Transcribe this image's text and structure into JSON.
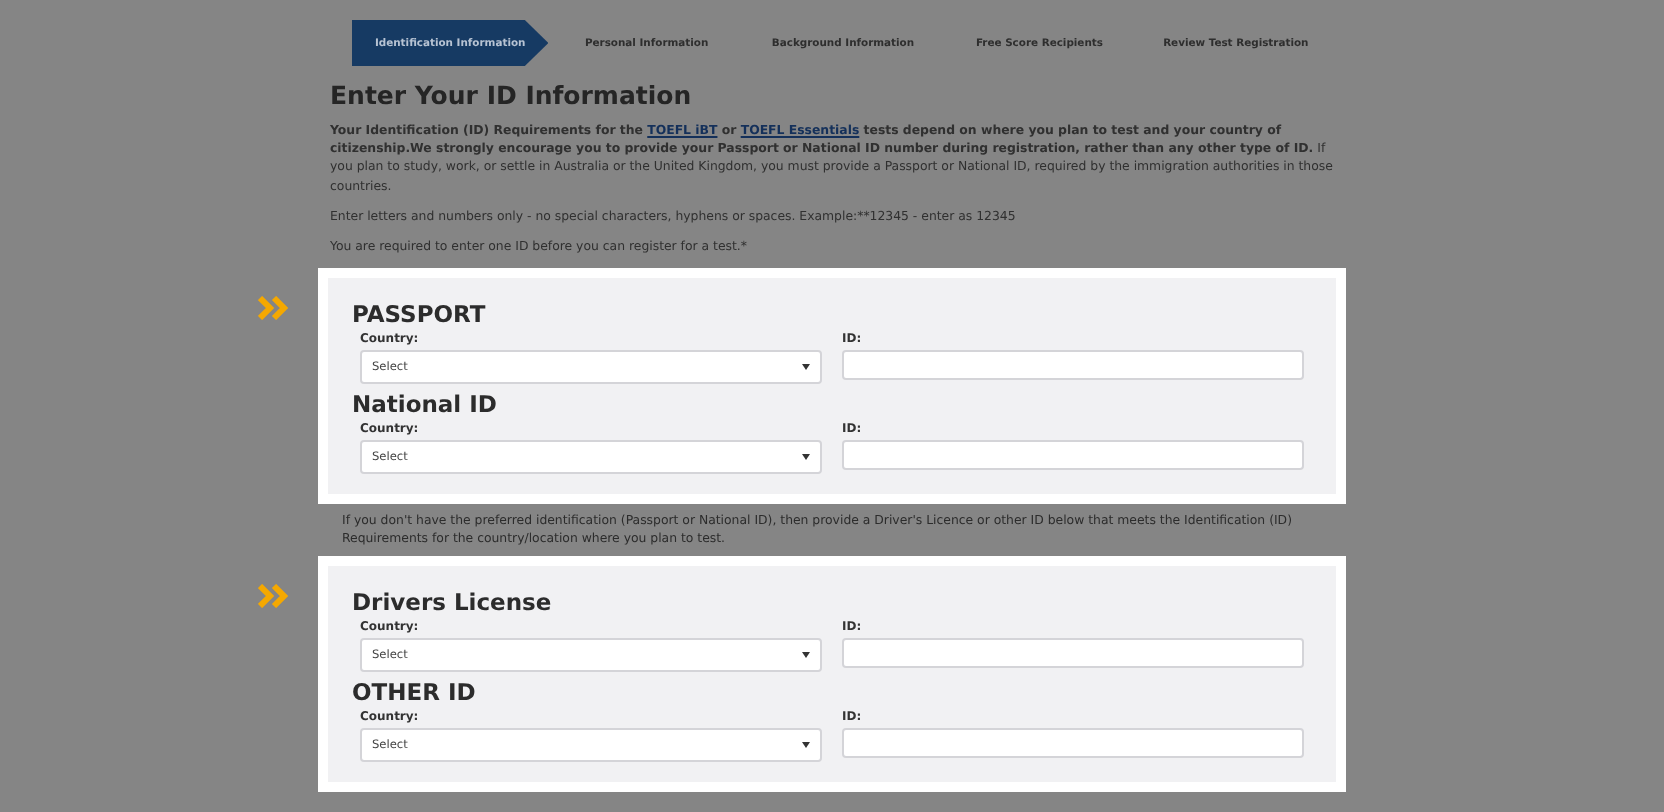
{
  "steps": [
    {
      "label": "Identification Information",
      "selected": true
    },
    {
      "label": "Personal Information",
      "selected": false
    },
    {
      "label": "Background Information",
      "selected": false
    },
    {
      "label": "Free Score Recipients",
      "selected": false
    },
    {
      "label": "Review Test Registration",
      "selected": false
    }
  ],
  "title": "Enter Your ID Information",
  "intro": [
    {
      "kind": "bold",
      "text": "Your Identification (ID) Requirements for the "
    },
    {
      "kind": "link",
      "text": "TOEFL iBT"
    },
    {
      "kind": "bold",
      "text": " or "
    },
    {
      "kind": "link",
      "text": "TOEFL Essentials"
    },
    {
      "kind": "bold",
      "text": " tests depend on where you plan to test and your country of citizenship.We strongly encourage you to provide your Passport or National ID number during registration, rather than any other type of ID."
    },
    {
      "kind": "plain",
      "text": " If you plan to study, work, or settle in Australia or the United Kingdom, you must provide a Passport or National ID, required by the immigration authorities in those countries."
    }
  ],
  "notes": [
    "Enter letters and numbers only - no special characters, hyphens or spaces. Example:**12345 - enter as 12345",
    "You are required to enter one ID before you can register for a test.*"
  ],
  "panels": [
    {
      "highlighted": true,
      "sections": [
        {
          "heading": "PASSPORT",
          "country_label": "Country:",
          "country_value": "Select",
          "id_label": "ID:"
        },
        {
          "heading": "National ID",
          "country_label": "Country:",
          "country_value": "Select",
          "id_label": "ID:"
        }
      ]
    },
    {
      "highlighted": true,
      "note": "If you don't have the preferred identification (Passport or National ID), then provide a Driver's Licence or other ID below that meets the Identification (ID) Requirements for the country/location where you plan to test.",
      "sections": [
        {
          "heading": "Drivers License",
          "country_label": "Country:",
          "country_value": "Select",
          "id_label": "ID:"
        },
        {
          "heading": "OTHER ID",
          "country_label": "Country:",
          "country_value": "Select",
          "id_label": "ID:"
        }
      ]
    }
  ]
}
